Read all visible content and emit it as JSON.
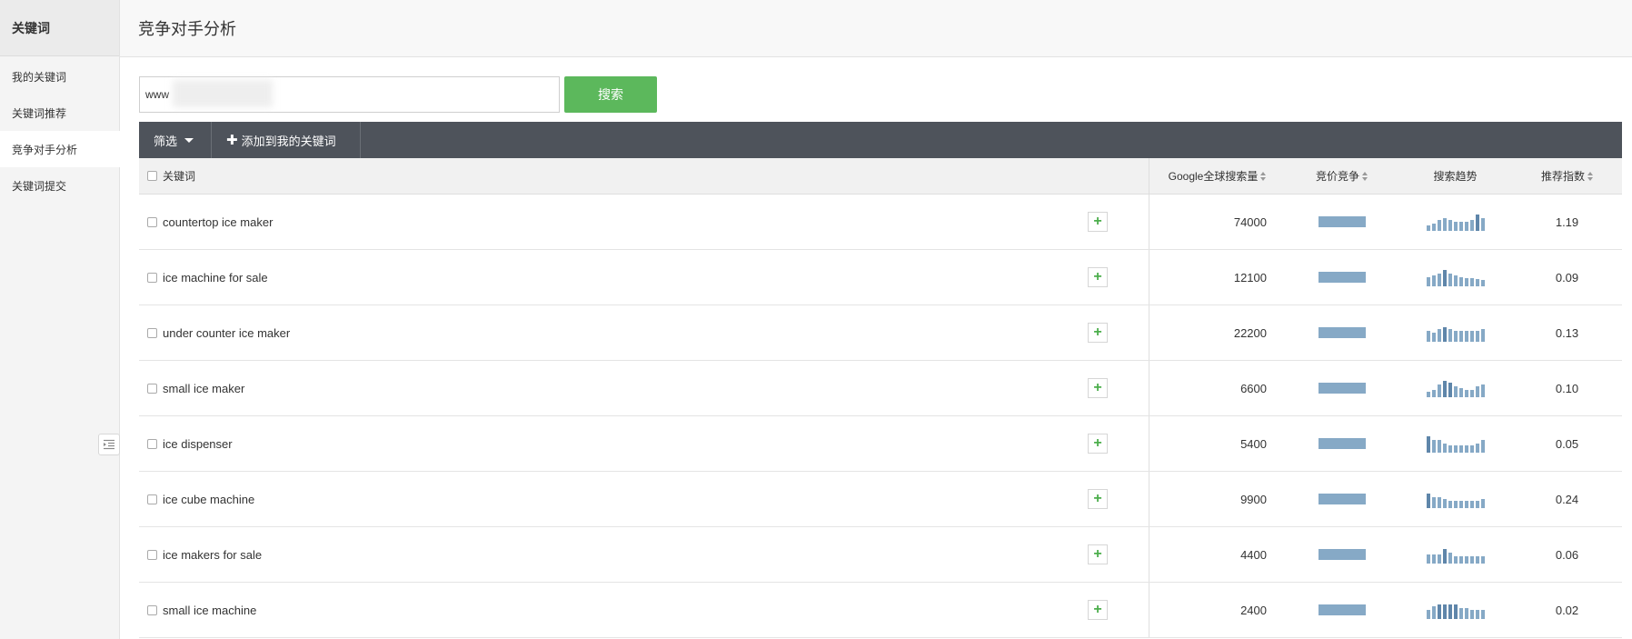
{
  "sidebar": {
    "header": "关键词",
    "items": [
      {
        "label": "我的关键词",
        "active": false
      },
      {
        "label": "关键词推荐",
        "active": false
      },
      {
        "label": "竞争对手分析",
        "active": true
      },
      {
        "label": "关键词提交",
        "active": false
      }
    ],
    "collapse_icon": "list-indent-icon"
  },
  "page": {
    "title": "竞争对手分析"
  },
  "search": {
    "value": "www",
    "button": "搜索"
  },
  "toolbar": {
    "filter": "筛选",
    "add": "添加到我的关键词"
  },
  "table": {
    "headers": {
      "keyword": "关键词",
      "volume": "Google全球搜索量",
      "bid": "竞价竞争",
      "trend": "搜索趋势",
      "recommend": "推荐指数"
    },
    "rows": [
      {
        "keyword": "countertop ice maker",
        "volume": "74000",
        "bid": 0.8,
        "trend": [
          6,
          8,
          12,
          14,
          12,
          10,
          10,
          10,
          12,
          18,
          14
        ],
        "recommend": "1.19"
      },
      {
        "keyword": "ice machine for sale",
        "volume": "12100",
        "bid": 0.8,
        "trend": [
          10,
          12,
          14,
          18,
          14,
          12,
          10,
          9,
          9,
          8,
          7
        ],
        "recommend": "0.09"
      },
      {
        "keyword": "under counter ice maker",
        "volume": "22200",
        "bid": 0.8,
        "trend": [
          12,
          10,
          14,
          16,
          14,
          12,
          12,
          12,
          12,
          12,
          14
        ],
        "recommend": "0.13"
      },
      {
        "keyword": "small ice maker",
        "volume": "6600",
        "bid": 0.8,
        "trend": [
          6,
          8,
          14,
          18,
          16,
          12,
          10,
          8,
          8,
          12,
          14
        ],
        "recommend": "0.10"
      },
      {
        "keyword": "ice dispenser",
        "volume": "5400",
        "bid": 0.8,
        "trend": [
          18,
          14,
          14,
          10,
          8,
          8,
          8,
          8,
          8,
          10,
          14
        ],
        "recommend": "0.05"
      },
      {
        "keyword": "ice cube machine",
        "volume": "9900",
        "bid": 0.8,
        "trend": [
          16,
          12,
          12,
          10,
          8,
          8,
          8,
          8,
          8,
          8,
          10
        ],
        "recommend": "0.24"
      },
      {
        "keyword": "ice makers for sale",
        "volume": "4400",
        "bid": 0.8,
        "trend": [
          10,
          10,
          10,
          16,
          12,
          8,
          8,
          8,
          8,
          8,
          8
        ],
        "recommend": "0.06"
      },
      {
        "keyword": "small ice machine",
        "volume": "2400",
        "bid": 0.8,
        "trend": [
          10,
          14,
          16,
          16,
          16,
          16,
          12,
          12,
          10,
          10,
          10
        ],
        "recommend": "0.02"
      }
    ]
  },
  "colors": {
    "accent_green": "#5cb85c",
    "toolbar_bg": "#4e535b",
    "bar_blue": "#86a9c6"
  }
}
